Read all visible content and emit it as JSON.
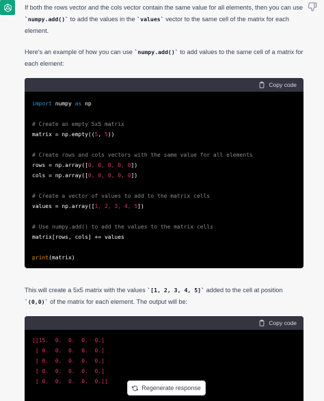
{
  "message": {
    "para1": {
      "t1": "If both the rows vector and the cols vector contain the same value for all elements, then you can use ",
      "c1": "`numpy.add()`",
      "t2": " to add the values in the ",
      "c2": "`values`",
      "t3": " vector to the same cell of the matrix for each element."
    },
    "para2": {
      "t1": "Here's an example of how you can use ",
      "c1": "`numpy.add()`",
      "t2": " to add values to the same cell of a matrix for each element:"
    },
    "para3": {
      "t1": "This will create a 5x5 matrix with the values ",
      "c1": "`[1, 2, 3, 4, 5]`",
      "t2": " added to the cell at position ",
      "c2": "`(0,0)`",
      "t3": " of the matrix for each element. The output will be:"
    }
  },
  "code1": {
    "copy_label": "Copy code",
    "l1_kw1": "import",
    "l1_mod": " numpy ",
    "l1_kw2": "as",
    "l1_alias": " np",
    "l3": "# Create an empty 5x5 matrix",
    "l4_a": "matrix = np.empty((",
    "l4_n1": "5",
    "l4_sep": ", ",
    "l4_n2": "5",
    "l4_b": "))",
    "l6": "# Create rows and cols vectors with the same value for all elements",
    "l7_a": "rows = np.array([",
    "l7_nums": "0, 0, 0, 0, 0",
    "l7_b": "])",
    "l8_a": "cols = np.array([",
    "l8_nums": "0, 0, 0, 0, 0",
    "l8_b": "])",
    "l10": "# Create a vector of values to add to the matrix cells",
    "l11_a": "values = np.array([",
    "l11_nums": "1, 2, 3, 4, 5",
    "l11_b": "])",
    "l13": "# Use numpy.add() to add the values to the matrix cells",
    "l14": "matrix[rows, cols] += values",
    "l16_fn": "print",
    "l16_rest": "(matrix)"
  },
  "code2": {
    "copy_label": "Copy code",
    "lines": [
      "[[15.  0.  0.  0.  0.]",
      " [ 0.  0.  0.  0.  0.]",
      " [ 0.  0.  0.  0.  0.]",
      " [ 0.  0.  0.  0.  0.]",
      " [ 0.  0.  0.  0.  0.]]"
    ]
  },
  "regenerate_label": "Regenerate response",
  "icons": {
    "avatar": "openai-logo-icon",
    "feedback": "thumbs-down-icon",
    "copy": "clipboard-icon",
    "regenerate": "refresh-icon"
  },
  "colors": {
    "avatar_bg": "#10a37f",
    "page_bg": "#f7f7f8",
    "code_bg": "#000000",
    "code_header_bg": "#343541",
    "keyword": "#2e95d3",
    "number": "#df3079",
    "comment": "#8a8a8a",
    "builtin": "#e9950c"
  }
}
